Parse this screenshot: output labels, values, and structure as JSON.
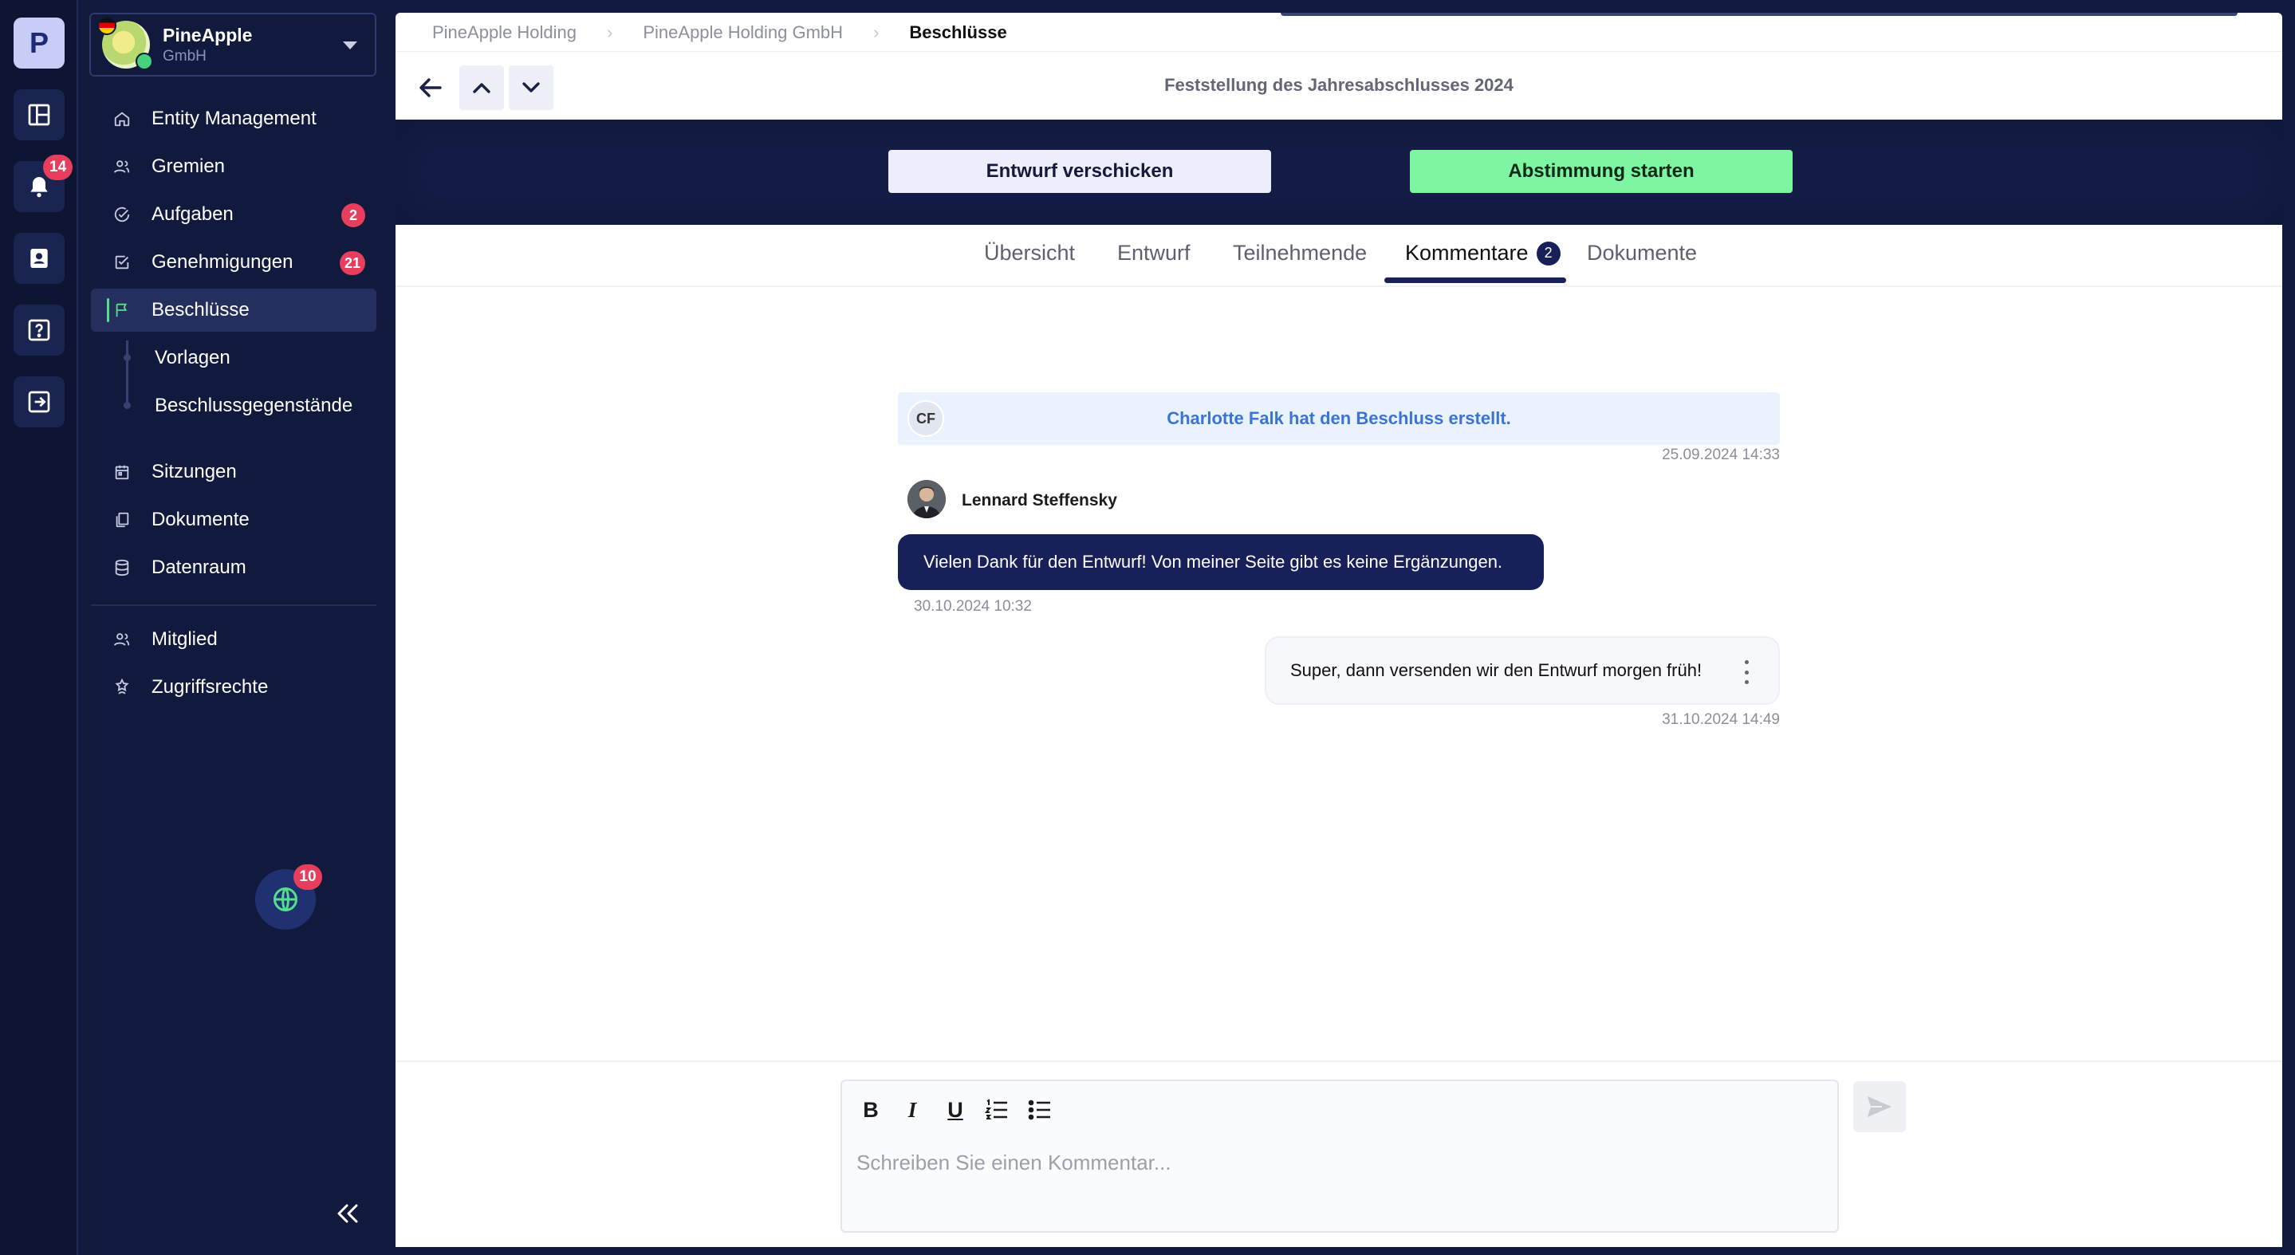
{
  "rail": {
    "logo_letter": "P",
    "notification_badge": "14",
    "items": [
      "logo-icon",
      "layout-icon",
      "bell-icon",
      "contact-icon",
      "help-icon",
      "logout-icon"
    ]
  },
  "org": {
    "name": "PineApple",
    "sub": "GmbH"
  },
  "nav": {
    "items": [
      {
        "label": "Entity Management",
        "icon": "home-icon"
      },
      {
        "label": "Gremien",
        "icon": "users-icon"
      },
      {
        "label": "Aufgaben",
        "icon": "check-circle-icon",
        "badge": "2"
      },
      {
        "label": "Genehmigungen",
        "icon": "check-square-icon",
        "badge": "21"
      },
      {
        "label": "Beschlüsse",
        "icon": "flag-icon",
        "active": true
      }
    ],
    "sub_items": [
      {
        "label": "Vorlagen"
      },
      {
        "label": "Beschlussgegenstände"
      }
    ],
    "items2": [
      {
        "label": "Sitzungen",
        "icon": "calendar-icon"
      },
      {
        "label": "Dokumente",
        "icon": "documents-icon"
      },
      {
        "label": "Datenraum",
        "icon": "database-icon"
      }
    ],
    "items3": [
      {
        "label": "Mitglied",
        "icon": "users-icon"
      },
      {
        "label": "Zugriffsrechte",
        "icon": "star-person-icon"
      }
    ],
    "help_badge": "10"
  },
  "breadcrumb": {
    "items": [
      "PineApple Holding",
      "PineApple Holding GmbH",
      "Beschlüsse"
    ]
  },
  "document": {
    "title": "Feststellung des Jahresabschlusses 2024"
  },
  "actions": {
    "send_draft": "Entwurf verschicken",
    "start_vote": "Abstimmung starten"
  },
  "tabs": {
    "items": [
      {
        "label": "Übersicht"
      },
      {
        "label": "Entwurf"
      },
      {
        "label": "Teilnehmende"
      },
      {
        "label": "Kommentare",
        "count": "2",
        "active": true
      },
      {
        "label": "Dokumente"
      }
    ]
  },
  "comments": {
    "system": {
      "initials": "CF",
      "text": "Charlotte Falk hat den Beschluss erstellt.",
      "timestamp": "25.09.2024 14:33"
    },
    "first": {
      "author": "Lennard Steffensky",
      "text": "Vielen Dank für den Entwurf! Von meiner Seite gibt es keine Ergänzungen.",
      "timestamp": "30.10.2024 10:32"
    },
    "second": {
      "text": "Super, dann versenden wir den Entwurf morgen früh!",
      "timestamp": "31.10.2024 14:49"
    }
  },
  "composer": {
    "placeholder": "Schreiben Sie einen Kommentar...",
    "tools": {
      "bold": "B",
      "italic": "I",
      "underline": "U"
    }
  },
  "colors": {
    "sidebar_bg": "#111a3d",
    "accent_navy": "#18205a",
    "accent_green": "#7ef5a0",
    "badge_red": "#e63e5c",
    "system_blue": "#3c74d3"
  }
}
